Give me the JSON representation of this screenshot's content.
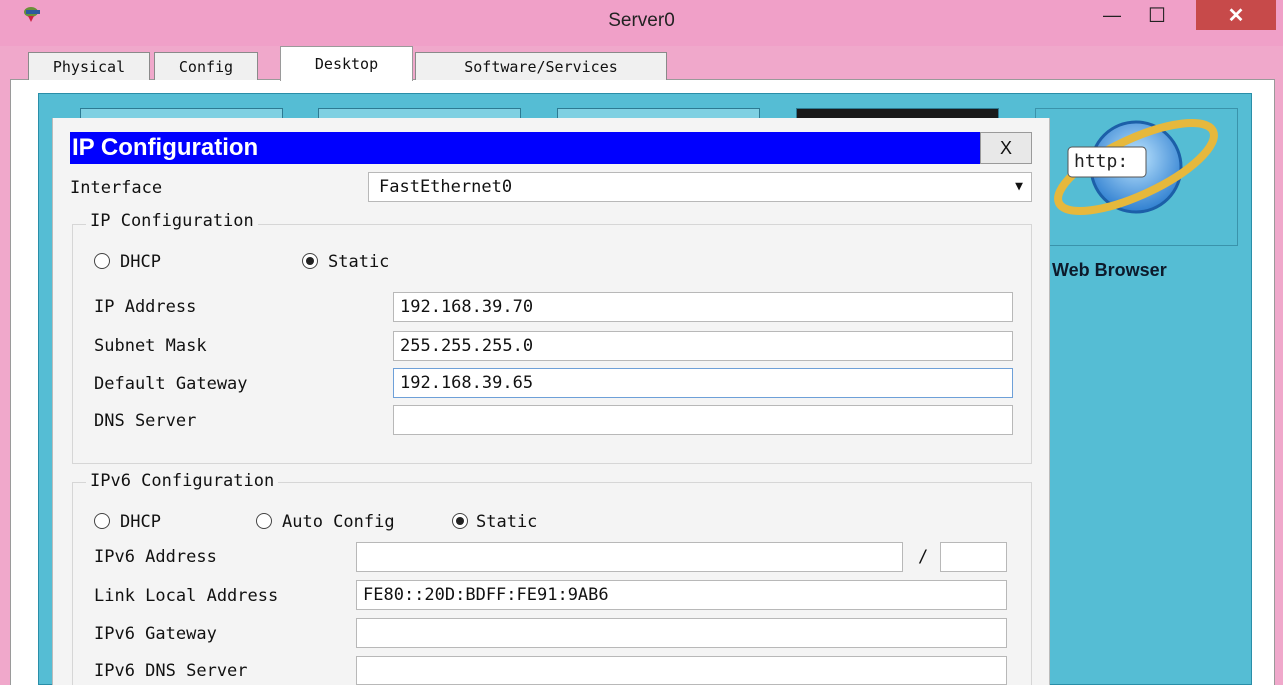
{
  "window": {
    "title": "Server0",
    "minimize_glyph": "—",
    "maximize_glyph": "☐",
    "close_glyph": "✕",
    "app_icon": "packet-tracer-server-icon",
    "close_color": "#c74a4a",
    "frame_color": "#f0a8cb"
  },
  "tabs": [
    {
      "label": "Physical"
    },
    {
      "label": "Config"
    },
    {
      "label": "Desktop",
      "active": true
    },
    {
      "label": "Software/Services"
    }
  ],
  "desktop": {
    "background_color": "#55bdd4",
    "web_browser": {
      "label": "Web Browser",
      "icon_text": "http:"
    }
  },
  "ipconfig": {
    "title": "IP Configuration",
    "close_label": "X",
    "title_bg": "#0000ff",
    "interface_label": "Interface",
    "interface_value": "FastEthernet0",
    "ipv4": {
      "legend": "IP Configuration",
      "dhcp_label": "DHCP",
      "static_label": "Static",
      "selected_mode": "Static",
      "ip_address_label": "IP Address",
      "ip_address_value": "192.168.39.70",
      "subnet_mask_label": "Subnet Mask",
      "subnet_mask_value": "255.255.255.0",
      "default_gateway_label": "Default Gateway",
      "default_gateway_value": "192.168.39.65",
      "dns_server_label": "DNS Server",
      "dns_server_value": ""
    },
    "ipv6": {
      "legend": "IPv6 Configuration",
      "dhcp_label": "DHCP",
      "auto_config_label": "Auto Config",
      "static_label": "Static",
      "selected_mode": "Static",
      "address_label": "IPv6 Address",
      "address_value": "",
      "prefix_separator": "/",
      "prefix_value": "",
      "link_local_label": "Link Local Address",
      "link_local_value": "FE80::20D:BDFF:FE91:9AB6",
      "gateway_label": "IPv6 Gateway",
      "gateway_value": "",
      "dns_label": "IPv6 DNS Server",
      "dns_value": ""
    }
  }
}
